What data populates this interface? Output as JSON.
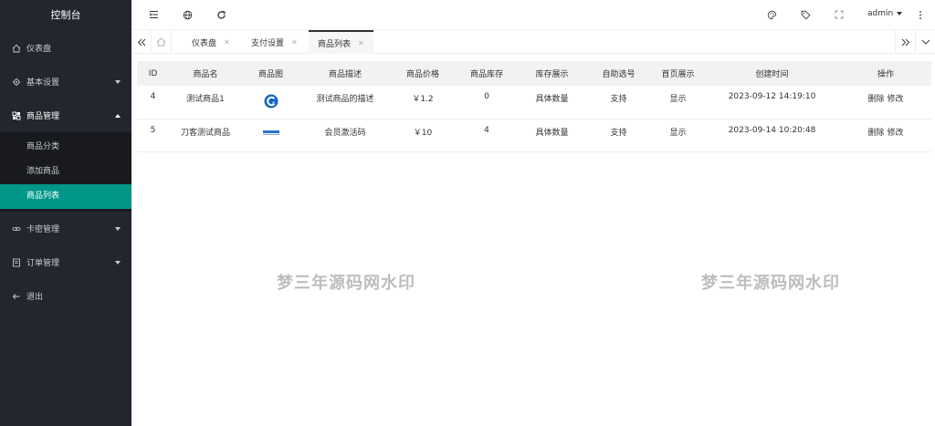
{
  "sidebar": {
    "title": "控制台",
    "items": [
      {
        "label": "仪表盘",
        "icon": "home-icon"
      },
      {
        "label": "基本设置",
        "icon": "gear-icon"
      },
      {
        "label": "商品管理",
        "icon": "product-icon"
      },
      {
        "label": "卡密管理",
        "icon": "link-icon"
      },
      {
        "label": "订单管理",
        "icon": "order-icon"
      },
      {
        "label": "退出",
        "icon": "logout-icon"
      }
    ],
    "submenu": [
      {
        "label": "商品分类"
      },
      {
        "label": "添加商品"
      },
      {
        "label": "商品列表"
      }
    ]
  },
  "header": {
    "user": "admin"
  },
  "tabs": [
    {
      "label": "仪表盘"
    },
    {
      "label": "支付设置"
    },
    {
      "label": "商品列表"
    }
  ],
  "table": {
    "columns": [
      "ID",
      "商品名",
      "商品图",
      "商品描述",
      "商品价格",
      "商品库存",
      "库存展示",
      "自助选号",
      "首页展示",
      "创建时间",
      "操作"
    ],
    "rows": [
      {
        "id": "4",
        "name": "测试商品1",
        "desc": "测试商品的描述",
        "price": "￥1.2",
        "stock": "0",
        "stock_show": "具体数量",
        "self_select": "支持",
        "home_show": "显示",
        "created": "2023-09-12 14:19:10",
        "delete": "删除",
        "edit": "修改"
      },
      {
        "id": "5",
        "name": "刀客测试商品",
        "desc": "会员激活码",
        "price": "￥10",
        "stock": "4",
        "stock_show": "具体数量",
        "self_select": "支持",
        "home_show": "显示",
        "created": "2023-09-14 10:20:48",
        "delete": "删除",
        "edit": "修改"
      }
    ]
  },
  "watermark": "梦三年源码网水印",
  "colors": {
    "sidebar_bg": "#23262e",
    "active": "#009688"
  }
}
